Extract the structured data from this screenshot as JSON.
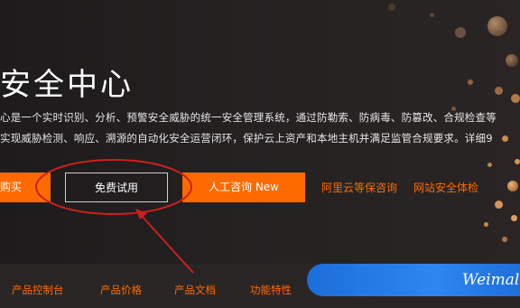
{
  "hero": {
    "title": "安全中心",
    "description_line1": "心是一个实时识别、分析、预警安全威胁的统一安全管理系统，通过防勒索、防病毒、防篡改、合规检查等",
    "description_line2": "实现威胁检测、响应、溯源的自动化安全运营闭环，保护云上资产和本地主机并满足监管合规要求。详细9"
  },
  "actions": {
    "buy_label": "购买",
    "trial_label": "免费试用",
    "consult_label": "人工咨询 New",
    "link_mlps": "阿里云等保咨询",
    "link_site_check": "网站安全体检"
  },
  "nav": {
    "items": [
      "产品控制台",
      "产品价格",
      "产品文档",
      "功能特性"
    ]
  },
  "watermark": {
    "text": "Weimal"
  },
  "colors": {
    "accent": "#ff6a00",
    "annotation": "#cc1f1f",
    "background": "#232020"
  }
}
